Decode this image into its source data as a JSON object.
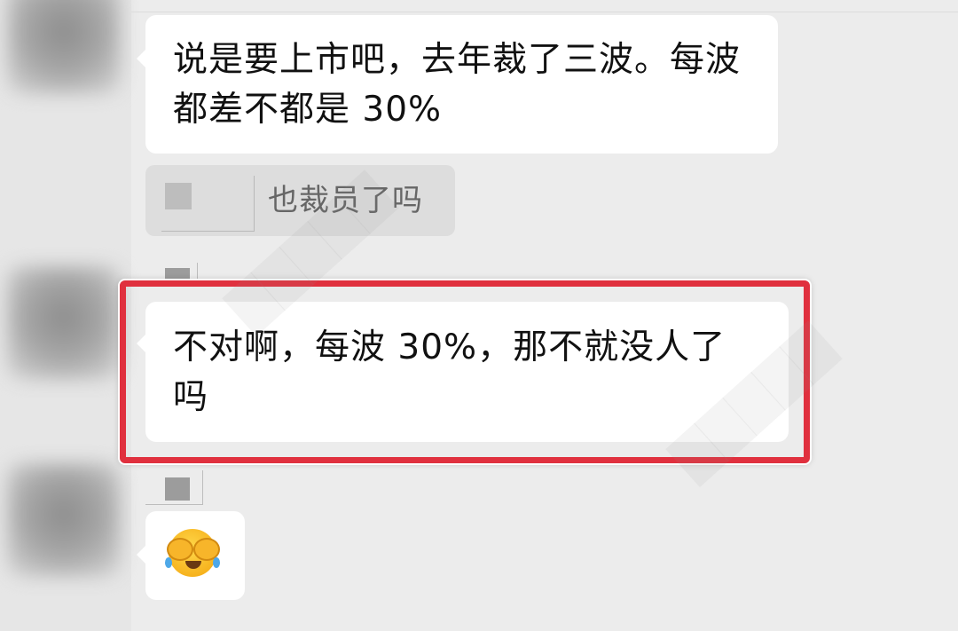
{
  "messages": [
    {
      "text": "说是要上市吧，去年裁了三波。每波都差不都是 30%"
    },
    {
      "quote_text": "也裁员了吗"
    },
    {
      "text": "不对啊，每波 30%，那不就没人了吗"
    },
    {
      "emoji_name": "face-palm-laughing-emoji"
    }
  ],
  "colors": {
    "chat_background": "#ececec",
    "bubble": "#ffffff",
    "quote_background": "#dddddd",
    "highlight_border": "#e0303e"
  }
}
